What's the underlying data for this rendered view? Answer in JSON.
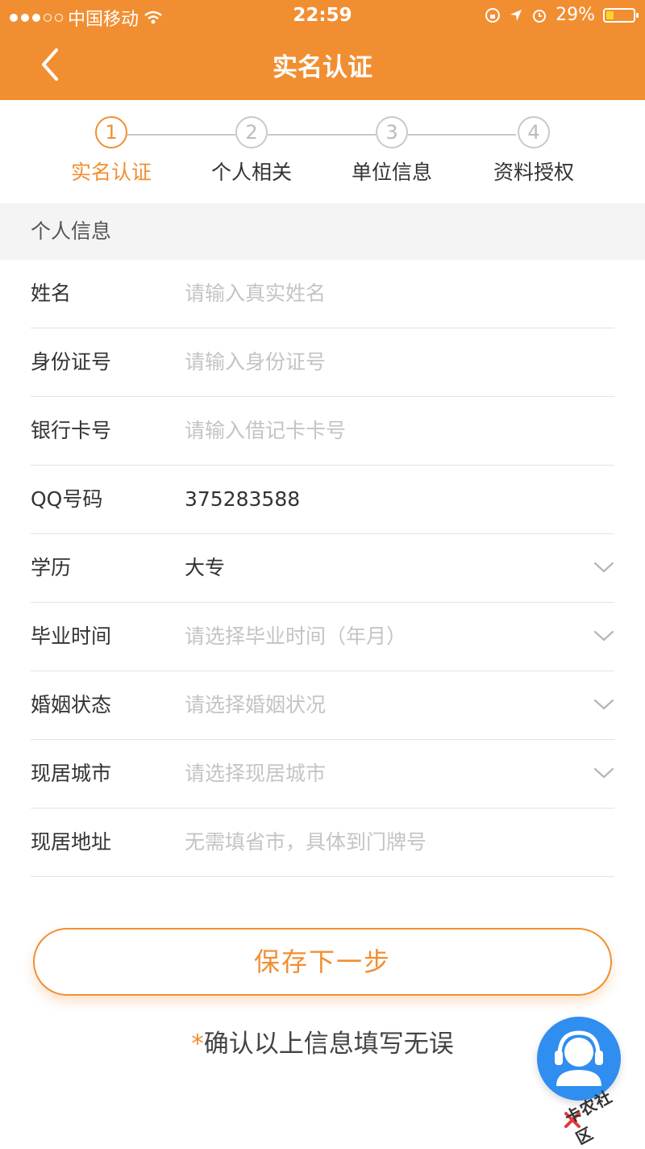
{
  "status_bar": {
    "carrier": "中国移动",
    "time": "22:59",
    "battery": "29%",
    "battery_level": 0.29
  },
  "nav": {
    "title": "实名认证",
    "back_icon": "chevron-left-icon"
  },
  "steps": [
    {
      "number": "1",
      "label": "实名认证",
      "active": true
    },
    {
      "number": "2",
      "label": "个人相关",
      "active": false
    },
    {
      "number": "3",
      "label": "单位信息",
      "active": false
    },
    {
      "number": "4",
      "label": "资料授权",
      "active": false
    }
  ],
  "section": {
    "title": "个人信息"
  },
  "form": {
    "fields": [
      {
        "label": "姓名",
        "placeholder": "请输入真实姓名",
        "value": "",
        "type": "input"
      },
      {
        "label": "身份证号",
        "placeholder": "请输入身份证号",
        "value": "",
        "type": "input"
      },
      {
        "label": "银行卡号",
        "placeholder": "请输入借记卡卡号",
        "value": "",
        "type": "input"
      },
      {
        "label": "QQ号码",
        "placeholder": "",
        "value": "375283588",
        "type": "input"
      },
      {
        "label": "学历",
        "placeholder": "",
        "value": "大专",
        "type": "select"
      },
      {
        "label": "毕业时间",
        "placeholder": "请选择毕业时间（年月）",
        "value": "",
        "type": "select"
      },
      {
        "label": "婚姻状态",
        "placeholder": "请选择婚姻状况",
        "value": "",
        "type": "select"
      },
      {
        "label": "现居城市",
        "placeholder": "请选择现居城市",
        "value": "",
        "type": "select"
      },
      {
        "label": "现居地址",
        "placeholder": "无需填省市，具体到门牌号",
        "value": "",
        "type": "input"
      }
    ]
  },
  "actions": {
    "save_label": "保存下一步",
    "confirm_star": "*",
    "confirm_text": "确认以上信息填写无误"
  },
  "floating": {
    "service_icon": "customer-service-headset-icon"
  },
  "watermark": {
    "text": "卡农社区"
  },
  "colors": {
    "accent": "#F28E32",
    "service_blue": "#2F8EF0",
    "placeholder": "#C4C4C4"
  }
}
